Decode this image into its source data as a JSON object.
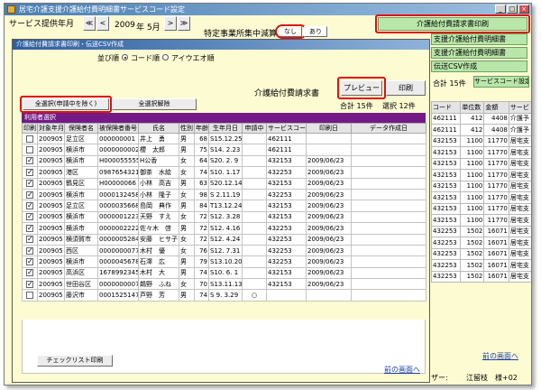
{
  "window": {
    "title": "居宅介護支援介護給付費明細書サービスコード設定"
  },
  "header": {
    "month_label": "サービス提供年月",
    "year": "2009",
    "year_unit": "年",
    "month": "5月",
    "prev_prev_label": "≪",
    "prev_label": "<",
    "next_label": ">",
    "next_next_label": "≫",
    "reduction_label": "特定事業所集中減算",
    "opt_none": "なし",
    "opt_yes": "あり"
  },
  "right_panel": {
    "btn_print_claim": "介護給付費請求書印刷",
    "btn_statement_1": "支援介護給付費明細書",
    "btn_statement_2": "支援介護給付費明細書",
    "btn_csv": "伝送CSV作成",
    "total_label": "合計 15件",
    "btn_service_code": "サービスコード設定",
    "table_headers": [
      "コード",
      "単位数",
      "金額",
      "サービ"
    ],
    "table_rows": [
      [
        "462111",
        "412",
        "4408",
        "介護予"
      ],
      [
        "462111",
        "412",
        "4408",
        "介護予"
      ],
      [
        "432153",
        "1100",
        "11770",
        "居宅支"
      ],
      [
        "432153",
        "1100",
        "11770",
        "居宅支"
      ],
      [
        "432153",
        "1100",
        "11770",
        "居宅支"
      ],
      [
        "432153",
        "1100",
        "11770",
        "居宅支"
      ],
      [
        "432153",
        "1100",
        "11770",
        "居宅支"
      ],
      [
        "432153",
        "1100",
        "11770",
        "居宅支"
      ],
      [
        "432153",
        "1100",
        "11770",
        "居宅支"
      ],
      [
        "432153",
        "1100",
        "11770",
        "居宅支"
      ],
      [
        "432253",
        "1502",
        "16071",
        "居宅支"
      ],
      [
        "432253",
        "1502",
        "16071",
        "居宅支"
      ],
      [
        "432253",
        "1502",
        "16071",
        "居宅支"
      ],
      [
        "432253",
        "1502",
        "16071",
        "居宅支"
      ],
      [
        "432253",
        "1502",
        "16071",
        "居宅支"
      ]
    ],
    "back_link": "前の画面へ",
    "footer_user_label": "ザー:",
    "footer_user_name": "江留枝　様+02"
  },
  "dialog": {
    "title": "介護給付費請求書印刷・伝送CSV作成",
    "sort_label": "並び順",
    "sort_code": "コード順",
    "sort_kana": "アイウエオ順",
    "heading": "介護給付費請求書",
    "btn_preview": "プレビュー",
    "btn_print": "印刷",
    "btn_select_all": "全選択(申請中を除く)",
    "btn_deselect_all": "全選択解除",
    "total": "合計 15件",
    "selected": "選択 12件",
    "section_title": "利用者選択",
    "columns": [
      "印刷",
      "対象年月",
      "保険者名",
      "被保険者番号",
      "氏名",
      "性別",
      "年齢",
      "生年月日",
      "申請中",
      "サービスコード",
      "印刷日",
      "データ作成日"
    ],
    "rows": [
      {
        "checked": false,
        "ym": "200905",
        "ins": "足立区",
        "num": "000000001",
        "name": "井上　勇",
        "sex": "男",
        "age": "68",
        "birth": "S15.12.25",
        "pending": "",
        "code": "462111",
        "printed": "",
        "created": ""
      },
      {
        "checked": false,
        "ym": "200905",
        "ins": "横浜市",
        "num": "0000000002",
        "name": "櫻　太郎",
        "sex": "男",
        "age": "75",
        "birth": "S14. 2.23",
        "pending": "",
        "code": "462111",
        "printed": "",
        "created": ""
      },
      {
        "checked": true,
        "ym": "200905",
        "ins": "横浜市",
        "num": "H000055555",
        "name": "H公香",
        "sex": "女",
        "age": "64",
        "birth": "S20. 2. 9",
        "pending": "",
        "code": "432153",
        "printed": "2009/06/23",
        "created": ""
      },
      {
        "checked": true,
        "ym": "200905",
        "ins": "港区",
        "num": "0987654321",
        "name": "御茶　水絵",
        "sex": "女",
        "age": "74",
        "birth": "S10. 1.17",
        "pending": "",
        "code": "432253",
        "printed": "2009/06/23",
        "created": ""
      },
      {
        "checked": true,
        "ym": "200905",
        "ins": "鶴見区",
        "num": "H00000066",
        "name": "小林　高吉",
        "sex": "男",
        "age": "63",
        "birth": "S20.12.14",
        "pending": "",
        "code": "432153",
        "printed": "2009/06/23",
        "created": ""
      },
      {
        "checked": true,
        "ym": "200905",
        "ins": "横浜市",
        "num": "0000132458",
        "name": "小林　隆子",
        "sex": "女",
        "age": "98",
        "birth": "S 2.11.19",
        "pending": "",
        "code": "432253",
        "printed": "2009/06/23",
        "created": ""
      },
      {
        "checked": true,
        "ym": "200905",
        "ins": "足立区",
        "num": "0000035668",
        "name": "島岡　典作",
        "sex": "男",
        "age": "84",
        "birth": "T13.12.24",
        "pending": "",
        "code": "432153",
        "printed": "2009/06/23",
        "created": ""
      },
      {
        "checked": true,
        "ym": "200905",
        "ins": "横浜市",
        "num": "0000001223",
        "name": "天野　すえ",
        "sex": "女",
        "age": "72",
        "birth": "S12. 3.28",
        "pending": "",
        "code": "432153",
        "printed": "2009/06/23",
        "created": ""
      },
      {
        "checked": true,
        "ym": "200905",
        "ins": "横浜市",
        "num": "0000002222",
        "name": "佐々木　啓",
        "sex": "男",
        "age": "72",
        "birth": "S12. 4.16",
        "pending": "",
        "code": "432253",
        "printed": "2009/06/23",
        "created": ""
      },
      {
        "checked": true,
        "ym": "200905",
        "ins": "横須賀市",
        "num": "0000005284",
        "name": "安藤　ヒサ子",
        "sex": "女",
        "age": "72",
        "birth": "S12. 4.24",
        "pending": "",
        "code": "432253",
        "printed": "2009/06/23",
        "created": ""
      },
      {
        "checked": true,
        "ym": "200905",
        "ins": "西区",
        "num": "0000000077",
        "name": "木村　優",
        "sex": "女",
        "age": "76",
        "birth": "S12. 7.31",
        "pending": "",
        "code": "432253",
        "printed": "2009/06/23",
        "created": ""
      },
      {
        "checked": true,
        "ym": "200905",
        "ins": "横浜市",
        "num": "0000045678",
        "name": "石澤　広",
        "sex": "男",
        "age": "79",
        "birth": "S13.10.20",
        "pending": "",
        "code": "432253",
        "printed": "2009/06/23",
        "created": ""
      },
      {
        "checked": true,
        "ym": "200905",
        "ins": "高浜区",
        "num": "1678992345",
        "name": "木村　大",
        "sex": "男",
        "age": "74",
        "birth": "S10. 6. 1",
        "pending": "",
        "code": "432153",
        "printed": "2009/06/23",
        "created": ""
      },
      {
        "checked": true,
        "ym": "200905",
        "ins": "世田谷区",
        "num": "0000000007",
        "name": "鵜野　ふね",
        "sex": "女",
        "age": "70",
        "birth": "S13.11.13",
        "pending": "",
        "code": "432153",
        "printed": "2009/06/23",
        "created": ""
      },
      {
        "checked": false,
        "ym": "200905",
        "ins": "藤沢市",
        "num": "0001525147",
        "name": "芦野　芳",
        "sex": "男",
        "age": "74",
        "birth": "S 9. 3.29",
        "pending": "○",
        "code": "",
        "printed": "",
        "created": ""
      }
    ],
    "btn_checklist": "チェックリスト印刷",
    "back_link": "前の画面へ"
  }
}
